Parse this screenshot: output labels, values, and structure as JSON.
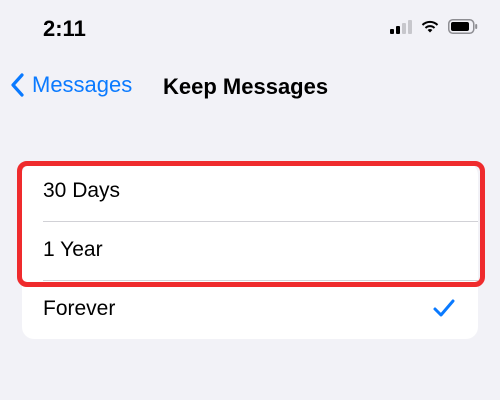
{
  "status_bar": {
    "time": "2:11",
    "icons": [
      "cellular-signal-icon",
      "wifi-icon",
      "battery-icon"
    ]
  },
  "nav": {
    "back_label": "Messages",
    "title": "Keep Messages"
  },
  "options": [
    {
      "label": "30 Days",
      "selected": false
    },
    {
      "label": "1 Year",
      "selected": false
    },
    {
      "label": "Forever",
      "selected": true
    }
  ],
  "colors": {
    "accent": "#0a7aff",
    "highlight": "#ef2b2d",
    "background": "#f2f2f7",
    "card": "#ffffff"
  }
}
